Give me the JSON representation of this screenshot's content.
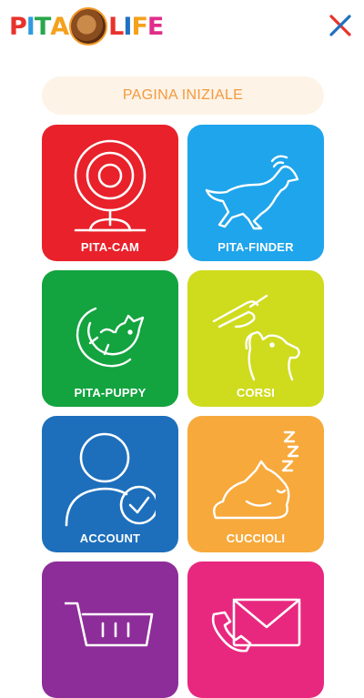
{
  "header": {
    "logo_letters": [
      "P",
      "I",
      "T",
      "A",
      "L",
      "I",
      "F",
      "E"
    ],
    "logo_colors": [
      "#e8322b",
      "#2f9be0",
      "#27a84a",
      "#f4a11c",
      "#e8322b",
      "#1f72c1",
      "#f4a11c",
      "#e02e8a"
    ]
  },
  "home_button": {
    "label": "PAGINA INIZIALE"
  },
  "tiles": [
    {
      "label": "PITA-CAM",
      "color": "#e8212a",
      "icon": "webcam-icon"
    },
    {
      "label": "PITA-FINDER",
      "color": "#1fa5eb",
      "icon": "running-dog-icon"
    },
    {
      "label": "PITA-PUPPY",
      "color": "#13a33f",
      "icon": "puppy-belly-icon"
    },
    {
      "label": "CORSI",
      "color": "#cfdb1d",
      "icon": "training-dog-icon"
    },
    {
      "label": "ACCOUNT",
      "color": "#1d6fbc",
      "icon": "user-check-icon"
    },
    {
      "label": "CUCCIOLI",
      "color": "#f7a93b",
      "icon": "sleeping-puppy-icon"
    },
    {
      "label": "",
      "color": "#8d2d99",
      "icon": "cart-icon"
    },
    {
      "label": "",
      "color": "#e8287f",
      "icon": "mail-phone-icon"
    }
  ],
  "colors": {
    "accent": "#f39a3d",
    "close": "#e8322b",
    "close_alt": "#1f6fc1"
  }
}
